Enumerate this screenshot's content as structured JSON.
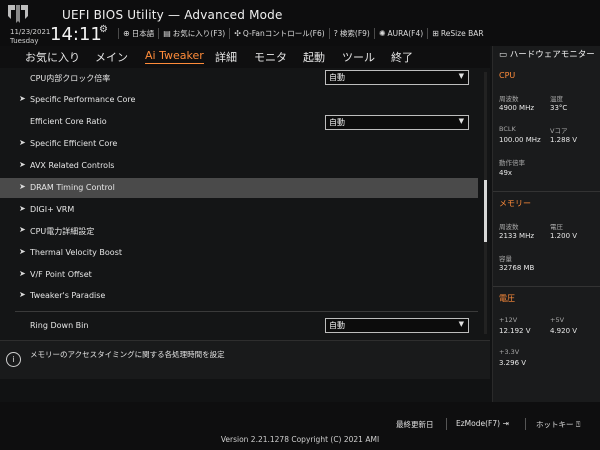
{
  "header": {
    "app_title": "UEFI BIOS Utility — Advanced Mode",
    "date": "11/23/2021",
    "day": "Tuesday",
    "time": "14:11",
    "toolbar": [
      {
        "icon": "globe-icon",
        "label": "日本語"
      },
      {
        "icon": "favorites-icon",
        "label": "お気に入り(F3)"
      },
      {
        "icon": "fan-icon",
        "label": "Q-Fanコントロール(F6)"
      },
      {
        "icon": "search-help-icon",
        "label": "検索(F9)"
      },
      {
        "icon": "aura-icon",
        "label": "AURA(F4)"
      },
      {
        "icon": "resize-bar-icon",
        "label": "ReSize BAR"
      }
    ]
  },
  "menu": [
    "お気に入り",
    "メイン",
    "Ai Tweaker",
    "詳細",
    "モニタ",
    "起動",
    "ツール",
    "終了"
  ],
  "menu_active": "Ai Tweaker",
  "items": [
    {
      "label": "CPU内部クロック倍率",
      "value": "自動",
      "submenu": false
    },
    {
      "label": "Specific Performance Core",
      "submenu": true
    },
    {
      "label": "Efficient Core Ratio",
      "value": "自動",
      "submenu": false
    },
    {
      "label": "Specific Efficient Core",
      "submenu": true
    },
    {
      "label": "AVX Related Controls",
      "submenu": true
    },
    {
      "label": "DRAM Timing Control",
      "submenu": true,
      "selected": true
    },
    {
      "label": "DIGI+ VRM",
      "submenu": true
    },
    {
      "label": "CPU電力詳細設定",
      "submenu": true
    },
    {
      "label": "Thermal Velocity Boost",
      "submenu": true
    },
    {
      "label": "V/F Point Offset",
      "submenu": true
    },
    {
      "label": "Tweaker's Paradise",
      "submenu": true
    },
    {
      "label": "Ring Down Bin",
      "value": "自動",
      "submenu": false
    }
  ],
  "description": "メモリーのアクセスタイミングに関する各処理時間を設定",
  "hardware_monitor": {
    "title": "ハードウェアモニター",
    "cpu": {
      "heading": "CPU",
      "freq_label": "周波数",
      "freq": "4900 MHz",
      "temp_label": "温度",
      "temp": "33°C",
      "bclk_label": "BCLK",
      "bclk": "100.00 MHz",
      "vcore_label": "Vコア",
      "vcore": "1.288 V",
      "ratio_label": "動作倍率",
      "ratio": "49x"
    },
    "memory": {
      "heading": "メモリー",
      "freq_label": "周波数",
      "freq": "2133 MHz",
      "volt_label": "電圧",
      "volt": "1.200 V",
      "cap_label": "容量",
      "cap": "32768 MB"
    },
    "voltage": {
      "heading": "電圧",
      "v12_label": "+12V",
      "v12": "12.192 V",
      "v5_label": "+5V",
      "v5": "4.920 V",
      "v33_label": "+3.3V",
      "v33": "3.296 V"
    }
  },
  "footer": {
    "last_modified": "最終更新日",
    "ezmode": "EzMode(F7)",
    "hotkeys": "ホットキー",
    "version": "Version 2.21.1278 Copyright (C) 2021 AMI"
  },
  "colors": {
    "accent": "#ff8c3a",
    "selected_row": "#4a4a4a",
    "background": "#141516"
  }
}
